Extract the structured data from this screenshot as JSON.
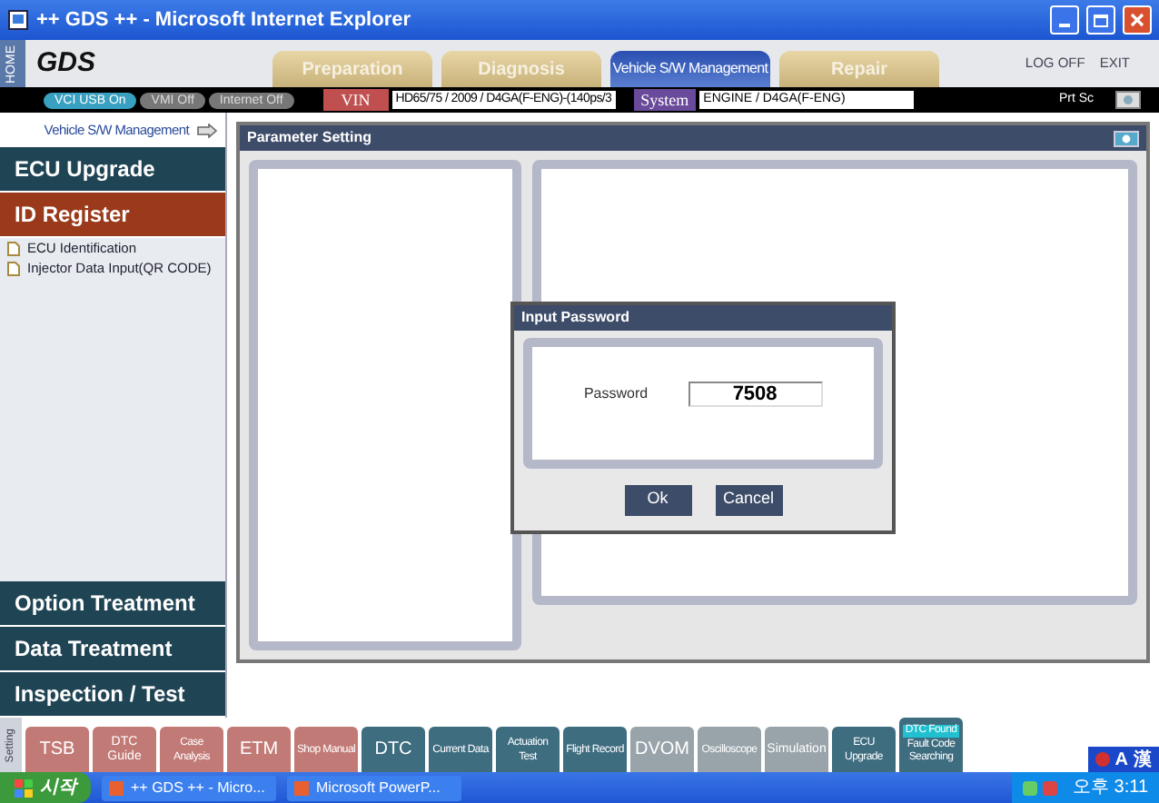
{
  "window": {
    "title": "++ GDS ++ - Microsoft Internet Explorer"
  },
  "header": {
    "home": "HOME",
    "logo": "GDS",
    "tabs": [
      {
        "label": "Preparation",
        "selected": false
      },
      {
        "label": "Diagnosis",
        "selected": false
      },
      {
        "label": "Vehicle S/W Management",
        "selected": true
      },
      {
        "label": "Repair",
        "selected": false
      }
    ],
    "links": [
      "LOG OFF",
      "EXIT"
    ]
  },
  "info_bar": {
    "indicators": [
      {
        "label": "VCI USB On",
        "on": true
      },
      {
        "label": "VMI Off",
        "on": false
      },
      {
        "label": "Internet Off",
        "on": false
      }
    ],
    "vin_label": "VIN",
    "vin": "HD65/75 / 2009 / D4GA(F-ENG)-(140ps/3",
    "system_label": "System",
    "system": "ENGINE / D4GA(F-ENG)",
    "print_screen": "Prt Sc"
  },
  "sidebar": {
    "title": "Vehicle S/W Management",
    "sections": [
      {
        "label": "ECU Upgrade",
        "selected": false
      },
      {
        "label": "ID Register",
        "selected": true,
        "items": [
          "ECU Identification",
          "Injector Data Input(QR CODE)"
        ]
      }
    ],
    "bottom_sections": [
      {
        "label": "Option Treatment",
        "selected": false
      },
      {
        "label": "Data Treatment",
        "selected": false
      },
      {
        "label": "Inspection / Test",
        "selected": false
      }
    ]
  },
  "panel": {
    "title": "Parameter Setting"
  },
  "dialog": {
    "title": "Input Password",
    "label": "Password",
    "value": "7508",
    "buttons": [
      "Ok",
      "Cancel"
    ]
  },
  "toolbar": {
    "label": "Setting",
    "buttons": [
      {
        "label": "TSB",
        "kind": "repair"
      },
      {
        "label": "DTC Guide",
        "kind": "repair"
      },
      {
        "label": "Case Analysis",
        "kind": "repair"
      },
      {
        "label": "ETM",
        "kind": "repair"
      },
      {
        "label": "Shop Manual",
        "kind": "repair"
      },
      {
        "label": "DTC",
        "kind": "diagnosis"
      },
      {
        "label": "Current Data",
        "kind": "diagnosis"
      },
      {
        "label": "Actuation Test",
        "kind": "diagnosis"
      },
      {
        "label": "Flight Record",
        "kind": "diagnosis"
      },
      {
        "label": "DVOM",
        "kind": "disabled"
      },
      {
        "label": "Oscilloscope",
        "kind": "disabled"
      },
      {
        "label": "Simulation",
        "kind": "disabled"
      },
      {
        "label": "ECU Upgrade",
        "kind": "diagnosis"
      },
      {
        "label": "Fault Code Searching",
        "kind": "diagnosis",
        "badge": "DTC Found"
      }
    ]
  },
  "language_bar": [
    "A",
    "漢"
  ],
  "taskbar": {
    "start": "시작",
    "tasks": [
      "++ GDS ++ - Micro...",
      "Microsoft PowerP..."
    ],
    "clock": "오후 3:11"
  }
}
